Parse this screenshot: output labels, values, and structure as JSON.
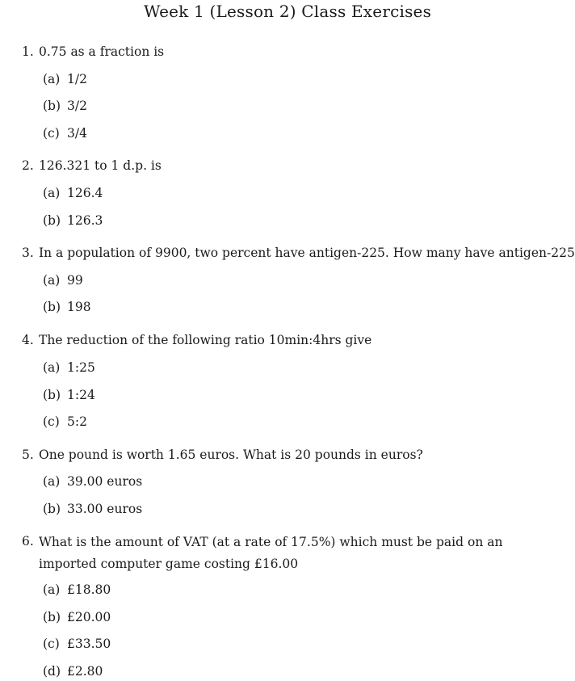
{
  "title": "Week 1 (Lesson 2) Class Exercises",
  "questions": [
    {
      "number": "1.",
      "text": "0.75 as a fraction is",
      "options": [
        {
          "label": "(a)",
          "text": "1/2"
        },
        {
          "label": "(b)",
          "text": "3/2"
        },
        {
          "label": "(c)",
          "text": "3/4"
        }
      ]
    },
    {
      "number": "2.",
      "text": "126.321 to 1 d.p. is",
      "options": [
        {
          "label": "(a)",
          "text": "126.4"
        },
        {
          "label": "(b)",
          "text": "126.3"
        }
      ]
    },
    {
      "number": "3.",
      "text": "In a population of 9900, two percent have antigen-225. How many have antigen-225",
      "options": [
        {
          "label": "(a)",
          "text": "99"
        },
        {
          "label": "(b)",
          "text": "198"
        }
      ]
    },
    {
      "number": "4.",
      "text": "The reduction of the following ratio 10min:4hrs give",
      "options": [
        {
          "label": "(a)",
          "text": "1:25"
        },
        {
          "label": "(b)",
          "text": "1:24"
        },
        {
          "label": "(c)",
          "text": "5:2"
        }
      ]
    },
    {
      "number": "5.",
      "text": "One pound is worth 1.65 euros. What is 20 pounds in euros?",
      "options": [
        {
          "label": "(a)",
          "text": "39.00 euros"
        },
        {
          "label": "(b)",
          "text": "33.00 euros"
        }
      ]
    },
    {
      "number": "6.",
      "text": "What is the amount of VAT (at a rate of 17.5%) which must be paid on an imported computer game costing £16.00",
      "options": [
        {
          "label": "(a)",
          "text": "£18.80"
        },
        {
          "label": "(b)",
          "text": "£20.00"
        },
        {
          "label": "(c)",
          "text": "£33.50"
        },
        {
          "label": "(d)",
          "text": "£2.80"
        }
      ]
    }
  ]
}
